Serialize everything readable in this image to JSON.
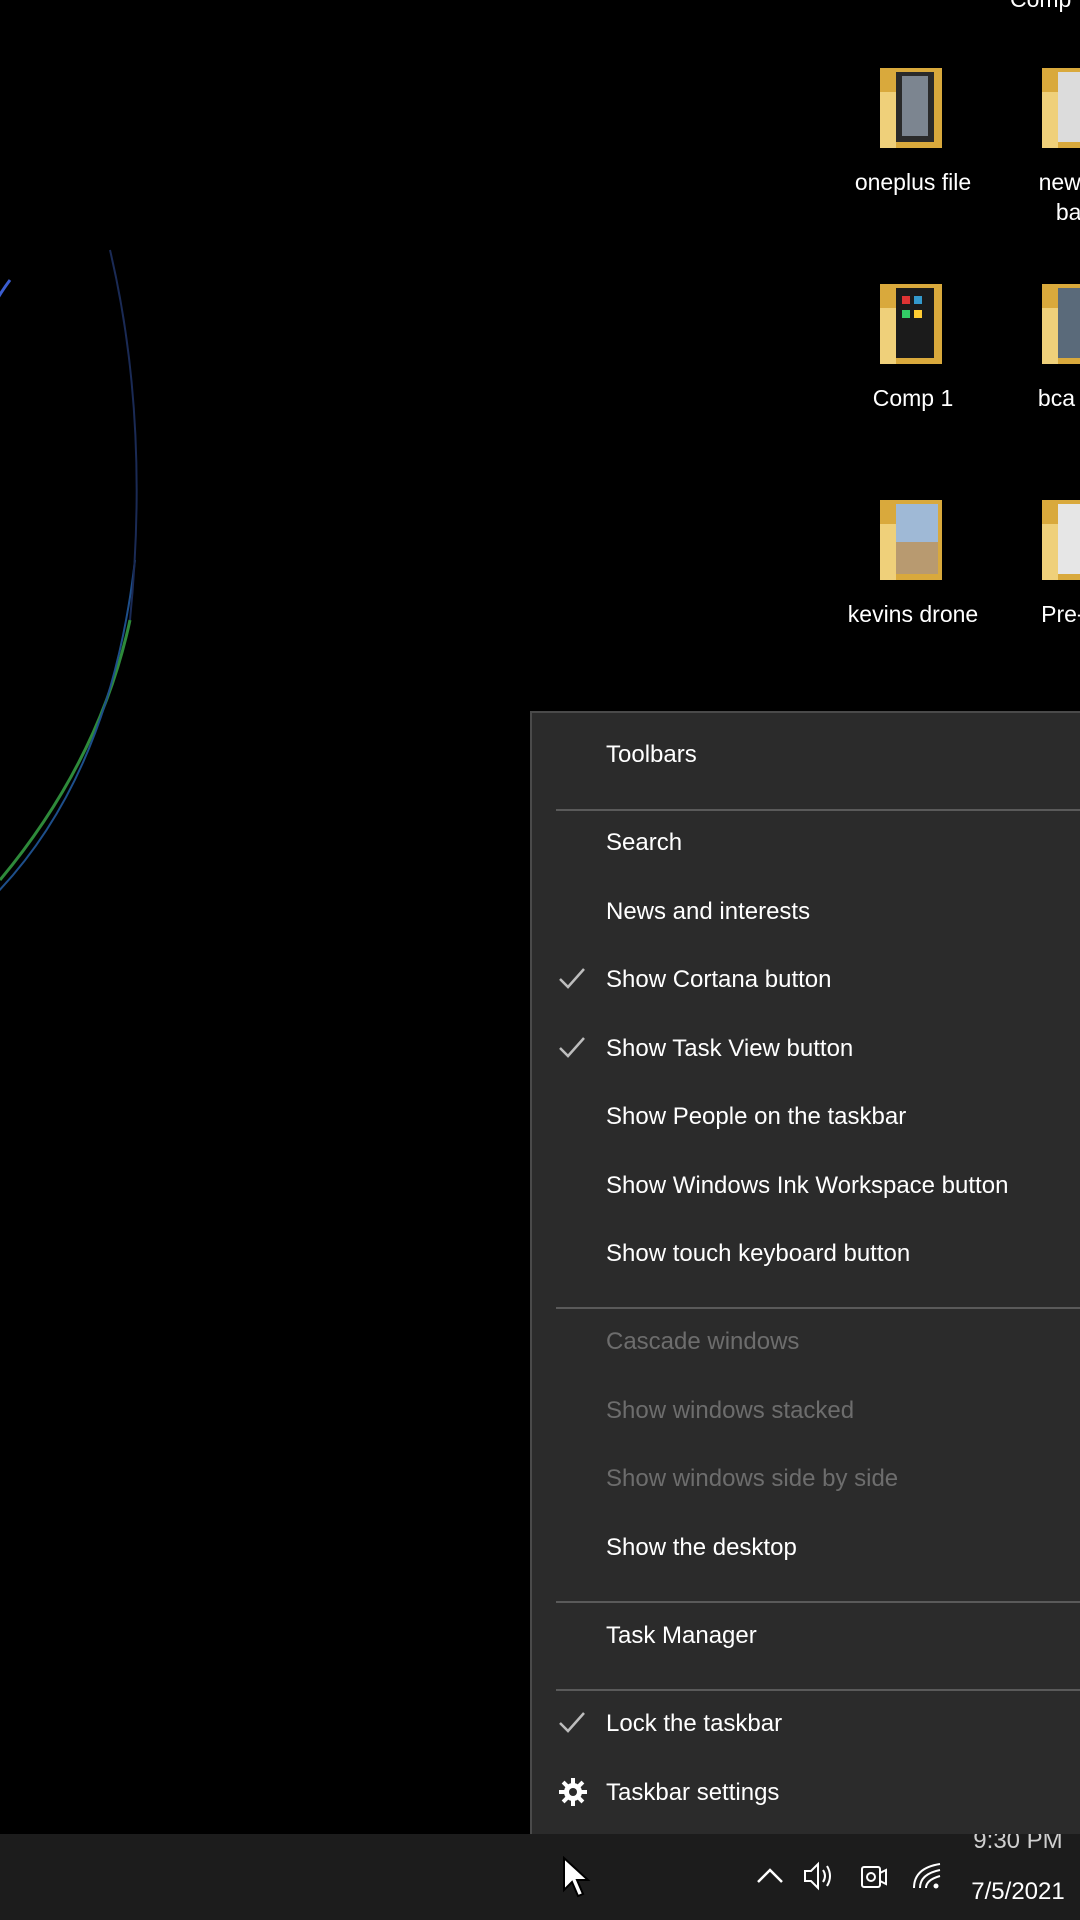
{
  "desktop": {
    "top_cut_label": "Comp",
    "icons": [
      {
        "name": "oneplus-file",
        "line1": "oneplus file",
        "line2": ""
      },
      {
        "name": "new-york-banner",
        "line1": "new yo",
        "line2": "ban"
      },
      {
        "name": "comp-1",
        "line1": "Comp 1",
        "line2": ""
      },
      {
        "name": "bca-logo",
        "line1": "bca log",
        "line2": ""
      },
      {
        "name": "kevins-drone",
        "line1": "kevins drone",
        "line2": ""
      },
      {
        "name": "pre-comp",
        "line1": "Pre-co",
        "line2": ""
      }
    ]
  },
  "menu": {
    "items": [
      {
        "label": "Toolbars",
        "checked": false,
        "disabled": false
      },
      {
        "label": "Search",
        "checked": false,
        "disabled": false
      },
      {
        "label": "News and interests",
        "checked": false,
        "disabled": false
      },
      {
        "label": "Show Cortana button",
        "checked": true,
        "disabled": false
      },
      {
        "label": "Show Task View button",
        "checked": true,
        "disabled": false
      },
      {
        "label": "Show People on the taskbar",
        "checked": false,
        "disabled": false
      },
      {
        "label": "Show Windows Ink Workspace button",
        "checked": false,
        "disabled": false
      },
      {
        "label": "Show touch keyboard button",
        "checked": false,
        "disabled": false
      },
      {
        "label": "Cascade windows",
        "checked": false,
        "disabled": true
      },
      {
        "label": "Show windows stacked",
        "checked": false,
        "disabled": true
      },
      {
        "label": "Show windows side by side",
        "checked": false,
        "disabled": true
      },
      {
        "label": "Show the desktop",
        "checked": false,
        "disabled": false
      },
      {
        "label": "Task Manager",
        "checked": false,
        "disabled": false
      },
      {
        "label": "Lock the taskbar",
        "checked": true,
        "disabled": false
      },
      {
        "label": "Taskbar settings",
        "checked": false,
        "disabled": false
      }
    ]
  },
  "taskbar": {
    "time": "9:30 PM",
    "date": "7/5/2021",
    "tray_icons": [
      "chevron-up-icon",
      "speaker-icon",
      "meet-now-icon",
      "wifi-icon"
    ]
  },
  "colors": {
    "menu_bg": "#2b2b2b",
    "disabled_text": "#6d6d6d",
    "taskbar_bg": "#1c1c1c",
    "folder": "#e8c25a"
  }
}
